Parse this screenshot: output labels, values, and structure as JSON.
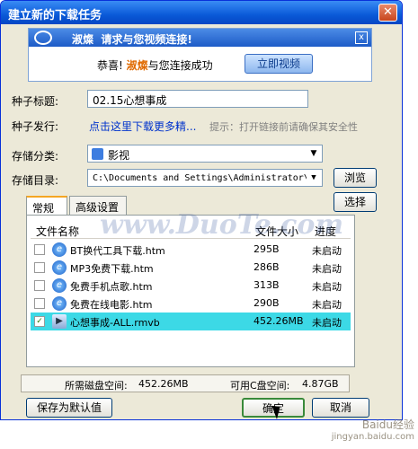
{
  "window": {
    "title": "建立新的下载任务",
    "close_label": "✕"
  },
  "banner": {
    "brand": "淑燦",
    "headline": "请求与您视频连接!",
    "message_prefix": "恭喜!",
    "message_brand": "淑燦",
    "message_suffix": "与您连接成功",
    "watch_button": "立即视频",
    "close_label": "x"
  },
  "form": {
    "seed_title_label": "种子标题:",
    "seed_title_value": "02.15心想事成",
    "seed_publish_label": "种子发行:",
    "seed_publish_link": "点击这里下载更多精...",
    "seed_publish_hint": "提示：打开链接前请确保其安全性",
    "category_label": "存储分类:",
    "category_value": "影视",
    "directory_label": "存储目录:",
    "directory_value": "C:\\Documents and Settings\\Administrator\\!",
    "browse_button": "浏览",
    "select_button": "选择"
  },
  "tabs": [
    {
      "label": "常规",
      "active": true
    },
    {
      "label": "高级设置",
      "active": false
    }
  ],
  "file_list": {
    "columns": [
      "文件名称",
      "文件大小",
      "进度"
    ],
    "rows": [
      {
        "name": "BT换代工具下载.htm",
        "size": "295B",
        "status": "未启动",
        "checked": false,
        "icon": "ie-file-icon"
      },
      {
        "name": "MP3免费下载.htm",
        "size": "286B",
        "status": "未启动",
        "checked": false,
        "icon": "ie-file-icon"
      },
      {
        "name": "免费手机点歌.htm",
        "size": "313B",
        "status": "未启动",
        "checked": false,
        "icon": "ie-file-icon"
      },
      {
        "name": "免费在线电影.htm",
        "size": "290B",
        "status": "未启动",
        "checked": false,
        "icon": "ie-file-icon"
      },
      {
        "name": "心想事成-ALL.rmvb",
        "size": "452.26MB",
        "status": "未启动",
        "checked": true,
        "icon": "movie-file-icon"
      }
    ]
  },
  "watermark": "www.DuoTe.com",
  "status": {
    "required_label": "所需磁盘空间:",
    "required_value": "452.26MB",
    "available_label": "可用C盘空间:",
    "available_value": "4.87GB"
  },
  "buttons": {
    "save_default": "保存为默认值",
    "ok": "确定",
    "cancel": "取消"
  },
  "corner_watermark": {
    "line1": "Baidu经验",
    "line2": "jingyan.baidu.com"
  },
  "colors": {
    "title_bar": "#0a5ad8",
    "selected_row": "#3cd9e6",
    "window_bg": "#ece9d8",
    "link": "#0033cc"
  }
}
